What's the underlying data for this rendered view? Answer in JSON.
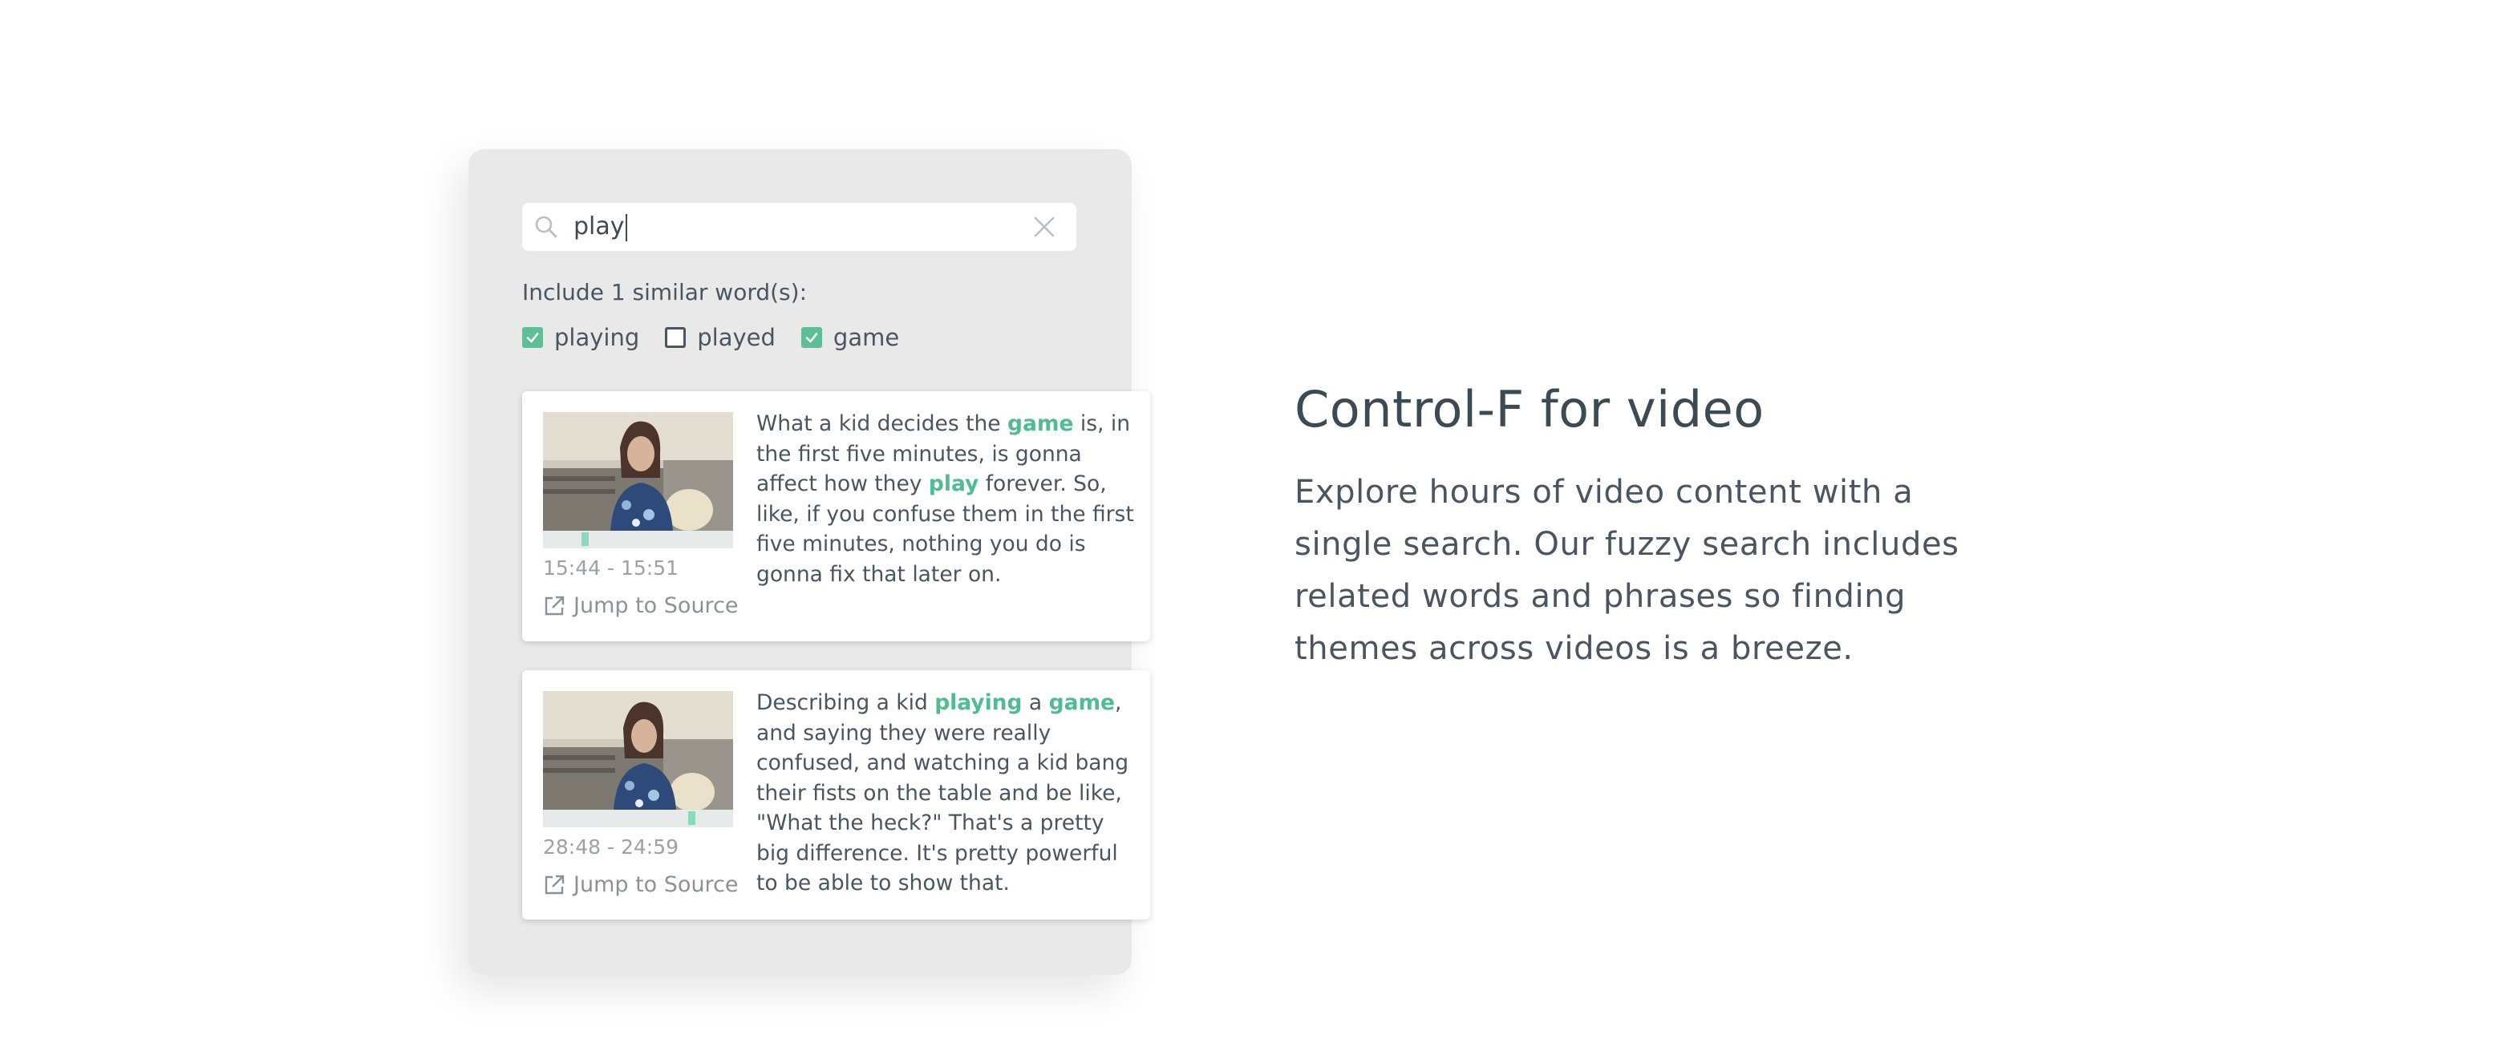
{
  "search": {
    "value": "play"
  },
  "similar": {
    "label": "Include 1 similar word(s):",
    "options": [
      {
        "label": "playing",
        "checked": true
      },
      {
        "label": "played",
        "checked": false
      },
      {
        "label": "game",
        "checked": true
      }
    ]
  },
  "results": [
    {
      "time_range": "15:44 - 15:51",
      "jump_label": "Jump to Source",
      "timeline_position": 0.22,
      "quote": [
        {
          "t": "What a kid decides the "
        },
        {
          "t": "game",
          "hl": true
        },
        {
          "t": " is, in the first five minutes, is gonna affect how they "
        },
        {
          "t": "play",
          "hl": true
        },
        {
          "t": " forever. So, like, if you confuse them in the first five minutes, nothing you do is gonna fix that later on."
        }
      ]
    },
    {
      "time_range": "28:48 - 24:59",
      "jump_label": "Jump to Source",
      "timeline_position": 0.78,
      "quote": [
        {
          "t": "Describing a kid "
        },
        {
          "t": "playing",
          "hl": true
        },
        {
          "t": " a "
        },
        {
          "t": "game",
          "hl": true
        },
        {
          "t": ", and saying they were really confused, and watching a kid bang their fists on the table and be like, \"What the heck?\" That's a pretty big difference. It's pretty powerful to be able to show that."
        }
      ]
    }
  ],
  "feature": {
    "title": "Control-F for video",
    "description": "Explore hours of video content with a single search. Our fuzzy search includes related words and phrases so finding themes across videos is a breeze."
  },
  "colors": {
    "accent": "#5cbf96",
    "highlight_text": "#4fbd8f",
    "panel": "#e9e9e9",
    "text": "#4a5560"
  },
  "icons": [
    "search-icon",
    "clear-icon",
    "check-icon",
    "external-link-icon"
  ]
}
